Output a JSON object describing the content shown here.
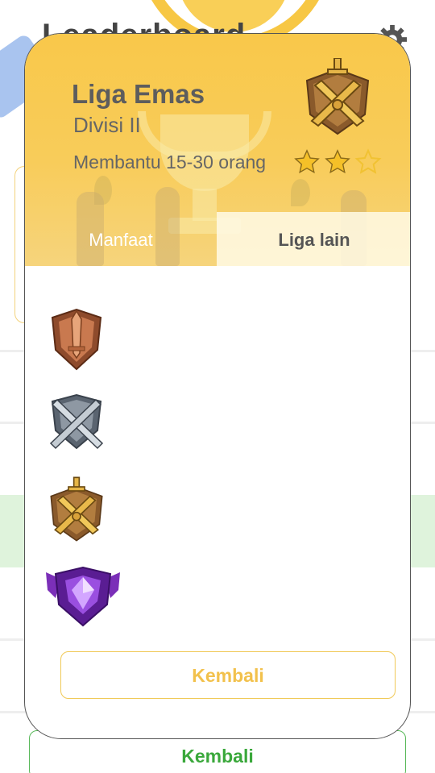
{
  "background": {
    "title": "Leaderboard",
    "back_label": "Kembali",
    "accent_green": "#3aa83b"
  },
  "modal": {
    "league_name": "Liga Emas",
    "division": "Divisi II",
    "helps_text": "Membantu 15-30 orang",
    "stars": {
      "filled": 2,
      "total": 3
    },
    "emblem_icon": "gold-crossed-swords-emblem-icon",
    "tabs": [
      {
        "label": "Manfaat",
        "active": false
      },
      {
        "label": "Liga lain",
        "active": true
      }
    ],
    "leagues": [
      {
        "icon": "bronze-shield-sword-emblem-icon"
      },
      {
        "icon": "silver-crossed-swords-emblem-icon"
      },
      {
        "icon": "gold-crossed-swords-emblem-icon"
      },
      {
        "icon": "purple-gem-emblem-icon"
      }
    ],
    "back_label": "Kembali",
    "colors": {
      "header": "#f9c84a",
      "accent_gold": "#f2c14c"
    }
  }
}
